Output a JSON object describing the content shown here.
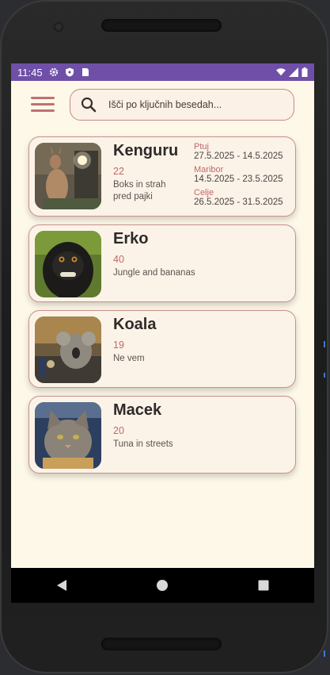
{
  "status_bar": {
    "time": "11:45"
  },
  "search": {
    "placeholder": "Išči po ključnih besedah..."
  },
  "animals": [
    {
      "name": "Kenguru",
      "age": "22",
      "description": "Boks in strah pred pajki",
      "trips": [
        {
          "city": "Ptuj",
          "dates": "27.5.2025 - 14.5.2025"
        },
        {
          "city": "Maribor",
          "dates": "14.5.2025 - 23.5.2025"
        },
        {
          "city": "Celje",
          "dates": "26.5.2025 - 31.5.2025"
        }
      ]
    },
    {
      "name": "Erko",
      "age": "40",
      "description": "Jungle and bananas",
      "trips": []
    },
    {
      "name": "Koala",
      "age": "19",
      "description": "Ne vem",
      "trips": []
    },
    {
      "name": "Macek",
      "age": "20",
      "description": "Tuna in streets",
      "trips": []
    }
  ],
  "colors": {
    "status_bar": "#6f4fa7",
    "background": "#fdf8e8",
    "accent": "#c0686a",
    "card": "#fcf3e8"
  },
  "icons": {
    "menu": "hamburger-menu-icon",
    "search": "search-icon",
    "back": "back-triangle-icon",
    "home": "home-circle-icon",
    "recents": "recents-square-icon"
  }
}
